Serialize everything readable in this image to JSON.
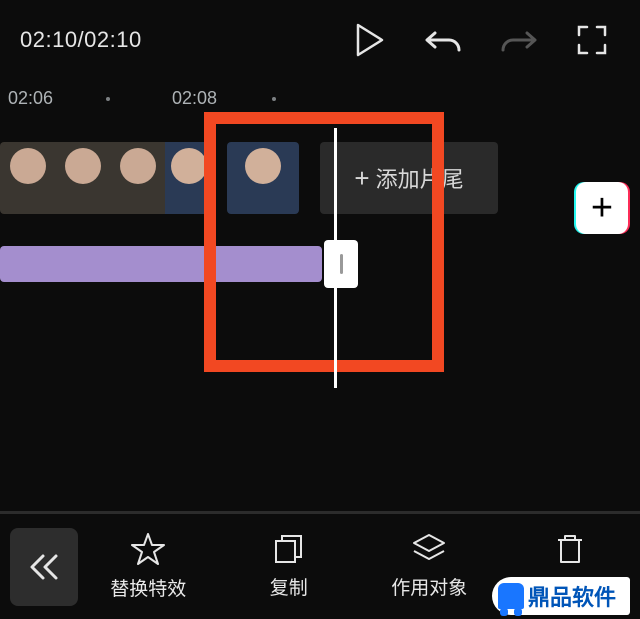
{
  "player": {
    "current_time": "02:10",
    "total_time": "02:10",
    "timecode_display": "02:10/02:10"
  },
  "ruler": {
    "marks": [
      "02:06",
      "02:08"
    ]
  },
  "timeline": {
    "add_ending_label": "添加片尾"
  },
  "fab": {
    "glyph": "+"
  },
  "toolbar": {
    "items": [
      {
        "id": "replace-effect",
        "label": "替换特效"
      },
      {
        "id": "copy",
        "label": "复制"
      },
      {
        "id": "target",
        "label": "作用对象"
      },
      {
        "id": "delete",
        "label": "删除"
      }
    ]
  },
  "watermark": {
    "text": "鼎品软件"
  }
}
